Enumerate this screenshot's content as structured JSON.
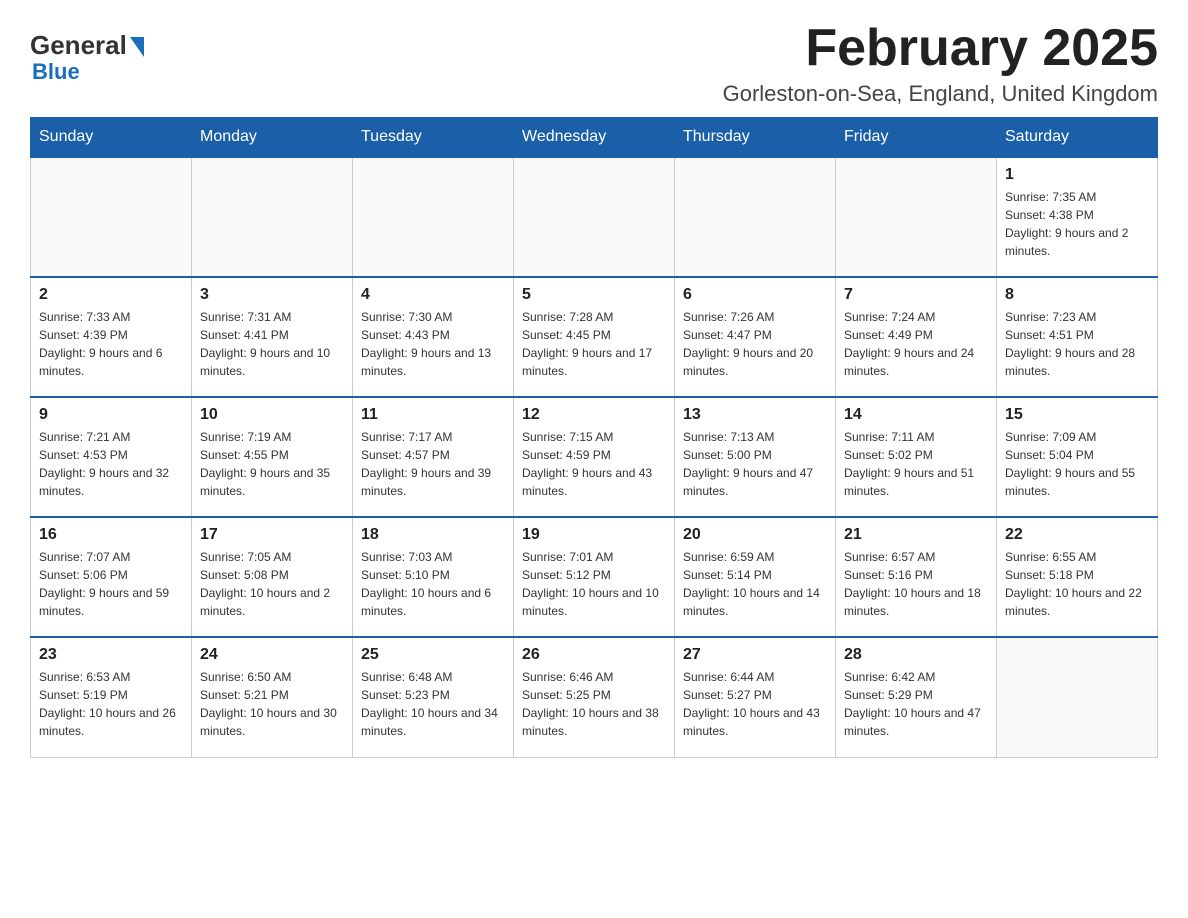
{
  "header": {
    "logo_line1": "General",
    "logo_line2": "Blue",
    "month_title": "February 2025",
    "location": "Gorleston-on-Sea, England, United Kingdom"
  },
  "weekdays": [
    "Sunday",
    "Monday",
    "Tuesday",
    "Wednesday",
    "Thursday",
    "Friday",
    "Saturday"
  ],
  "weeks": [
    [
      {
        "day": "",
        "info": ""
      },
      {
        "day": "",
        "info": ""
      },
      {
        "day": "",
        "info": ""
      },
      {
        "day": "",
        "info": ""
      },
      {
        "day": "",
        "info": ""
      },
      {
        "day": "",
        "info": ""
      },
      {
        "day": "1",
        "info": "Sunrise: 7:35 AM\nSunset: 4:38 PM\nDaylight: 9 hours and 2 minutes."
      }
    ],
    [
      {
        "day": "2",
        "info": "Sunrise: 7:33 AM\nSunset: 4:39 PM\nDaylight: 9 hours and 6 minutes."
      },
      {
        "day": "3",
        "info": "Sunrise: 7:31 AM\nSunset: 4:41 PM\nDaylight: 9 hours and 10 minutes."
      },
      {
        "day": "4",
        "info": "Sunrise: 7:30 AM\nSunset: 4:43 PM\nDaylight: 9 hours and 13 minutes."
      },
      {
        "day": "5",
        "info": "Sunrise: 7:28 AM\nSunset: 4:45 PM\nDaylight: 9 hours and 17 minutes."
      },
      {
        "day": "6",
        "info": "Sunrise: 7:26 AM\nSunset: 4:47 PM\nDaylight: 9 hours and 20 minutes."
      },
      {
        "day": "7",
        "info": "Sunrise: 7:24 AM\nSunset: 4:49 PM\nDaylight: 9 hours and 24 minutes."
      },
      {
        "day": "8",
        "info": "Sunrise: 7:23 AM\nSunset: 4:51 PM\nDaylight: 9 hours and 28 minutes."
      }
    ],
    [
      {
        "day": "9",
        "info": "Sunrise: 7:21 AM\nSunset: 4:53 PM\nDaylight: 9 hours and 32 minutes."
      },
      {
        "day": "10",
        "info": "Sunrise: 7:19 AM\nSunset: 4:55 PM\nDaylight: 9 hours and 35 minutes."
      },
      {
        "day": "11",
        "info": "Sunrise: 7:17 AM\nSunset: 4:57 PM\nDaylight: 9 hours and 39 minutes."
      },
      {
        "day": "12",
        "info": "Sunrise: 7:15 AM\nSunset: 4:59 PM\nDaylight: 9 hours and 43 minutes."
      },
      {
        "day": "13",
        "info": "Sunrise: 7:13 AM\nSunset: 5:00 PM\nDaylight: 9 hours and 47 minutes."
      },
      {
        "day": "14",
        "info": "Sunrise: 7:11 AM\nSunset: 5:02 PM\nDaylight: 9 hours and 51 minutes."
      },
      {
        "day": "15",
        "info": "Sunrise: 7:09 AM\nSunset: 5:04 PM\nDaylight: 9 hours and 55 minutes."
      }
    ],
    [
      {
        "day": "16",
        "info": "Sunrise: 7:07 AM\nSunset: 5:06 PM\nDaylight: 9 hours and 59 minutes."
      },
      {
        "day": "17",
        "info": "Sunrise: 7:05 AM\nSunset: 5:08 PM\nDaylight: 10 hours and 2 minutes."
      },
      {
        "day": "18",
        "info": "Sunrise: 7:03 AM\nSunset: 5:10 PM\nDaylight: 10 hours and 6 minutes."
      },
      {
        "day": "19",
        "info": "Sunrise: 7:01 AM\nSunset: 5:12 PM\nDaylight: 10 hours and 10 minutes."
      },
      {
        "day": "20",
        "info": "Sunrise: 6:59 AM\nSunset: 5:14 PM\nDaylight: 10 hours and 14 minutes."
      },
      {
        "day": "21",
        "info": "Sunrise: 6:57 AM\nSunset: 5:16 PM\nDaylight: 10 hours and 18 minutes."
      },
      {
        "day": "22",
        "info": "Sunrise: 6:55 AM\nSunset: 5:18 PM\nDaylight: 10 hours and 22 minutes."
      }
    ],
    [
      {
        "day": "23",
        "info": "Sunrise: 6:53 AM\nSunset: 5:19 PM\nDaylight: 10 hours and 26 minutes."
      },
      {
        "day": "24",
        "info": "Sunrise: 6:50 AM\nSunset: 5:21 PM\nDaylight: 10 hours and 30 minutes."
      },
      {
        "day": "25",
        "info": "Sunrise: 6:48 AM\nSunset: 5:23 PM\nDaylight: 10 hours and 34 minutes."
      },
      {
        "day": "26",
        "info": "Sunrise: 6:46 AM\nSunset: 5:25 PM\nDaylight: 10 hours and 38 minutes."
      },
      {
        "day": "27",
        "info": "Sunrise: 6:44 AM\nSunset: 5:27 PM\nDaylight: 10 hours and 43 minutes."
      },
      {
        "day": "28",
        "info": "Sunrise: 6:42 AM\nSunset: 5:29 PM\nDaylight: 10 hours and 47 minutes."
      },
      {
        "day": "",
        "info": ""
      }
    ]
  ]
}
